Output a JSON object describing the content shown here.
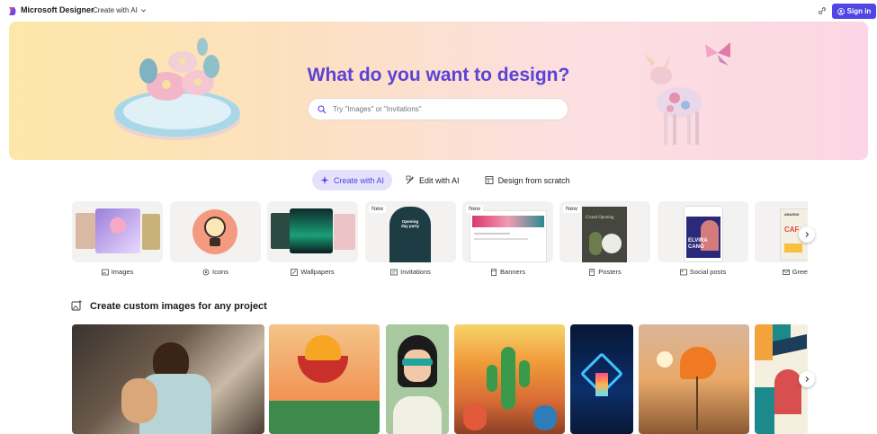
{
  "header": {
    "brand": "Microsoft Designer",
    "create_menu_label": "Create with AI",
    "signin_label": "Sign in"
  },
  "hero": {
    "title": "What do you want to design?",
    "search_placeholder": "Try \"Images\" or \"Invitations\""
  },
  "tabs": [
    {
      "label": "Create with AI",
      "active": true
    },
    {
      "label": "Edit with AI",
      "active": false
    },
    {
      "label": "Design from scratch",
      "active": false
    }
  ],
  "categories": [
    {
      "label": "Images",
      "icon": "image-icon",
      "badge": ""
    },
    {
      "label": "Icons",
      "icon": "icon-icon",
      "badge": ""
    },
    {
      "label": "Wallpapers",
      "icon": "wallpaper-icon",
      "badge": ""
    },
    {
      "label": "Invitations",
      "icon": "invitation-icon",
      "badge": "New"
    },
    {
      "label": "Banners",
      "icon": "banner-icon",
      "badge": "New"
    },
    {
      "label": "Posters",
      "icon": "poster-icon",
      "badge": "New"
    },
    {
      "label": "Social posts",
      "icon": "social-post-icon",
      "badge": ""
    },
    {
      "label": "Greeting",
      "icon": "greeting-icon",
      "badge": ""
    }
  ],
  "thumb_text": {
    "invitation_title": "Opening day party",
    "poster_title": "Grand Opening",
    "social_name_1": "ELVIRA",
    "social_name_2": "CANO",
    "greeting_text_1": "CAF",
    "greeting_text_2": "AMAZING"
  },
  "section": {
    "title": "Create custom images for any project"
  },
  "colors": {
    "accent": "#4f46e5",
    "title": "#5b43d6",
    "active_tab_bg": "#e5e1fb"
  }
}
